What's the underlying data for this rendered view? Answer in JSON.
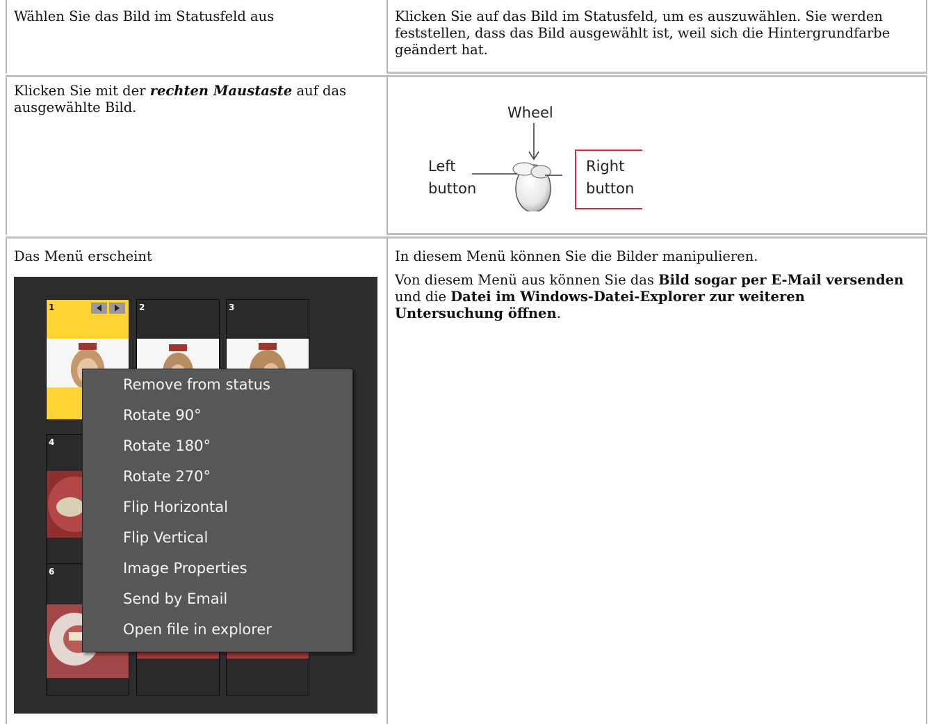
{
  "row1": {
    "left": "Wählen Sie das Bild im Statusfeld aus",
    "right": "Klicken Sie auf das Bild im Statusfeld, um es auszuwählen. Sie werden feststellen, dass das Bild ausgewählt ist, weil sich die Hintergrundfarbe geändert hat."
  },
  "row2": {
    "left_pre": "Klicken Sie mit der ",
    "left_em": "rechten Maustaste",
    "left_post": " auf das ausgewählte Bild.",
    "diagram": {
      "wheel": "Wheel",
      "left_line1": "Left",
      "left_line2": "button",
      "right_line1": "Right",
      "right_line2": "button"
    }
  },
  "row3": {
    "left": "Das Menü erscheint",
    "right_p1": "In diesem Menü können Sie die Bilder manipulieren.",
    "right_p2_a": "Von diesem Menü aus können Sie das ",
    "right_p2_b": "Bild sogar per E-Mail versenden",
    "right_p2_c": " und die ",
    "right_p2_d": "Datei im Windows-Datei-Explorer zur weiteren Untersuchung öffnen",
    "right_p2_e": "."
  },
  "status_panel": {
    "thumbnails": [
      "1",
      "2",
      "3",
      "4",
      "6"
    ],
    "selected": "1",
    "accent": "#ffd432"
  },
  "context_menu": {
    "items": [
      "Remove from status",
      "Rotate 90°",
      "Rotate 180°",
      "Rotate 270°",
      "Flip Horizontal",
      "Flip Vertical",
      "Image Properties",
      "Send by Email",
      "Open file in explorer"
    ]
  }
}
